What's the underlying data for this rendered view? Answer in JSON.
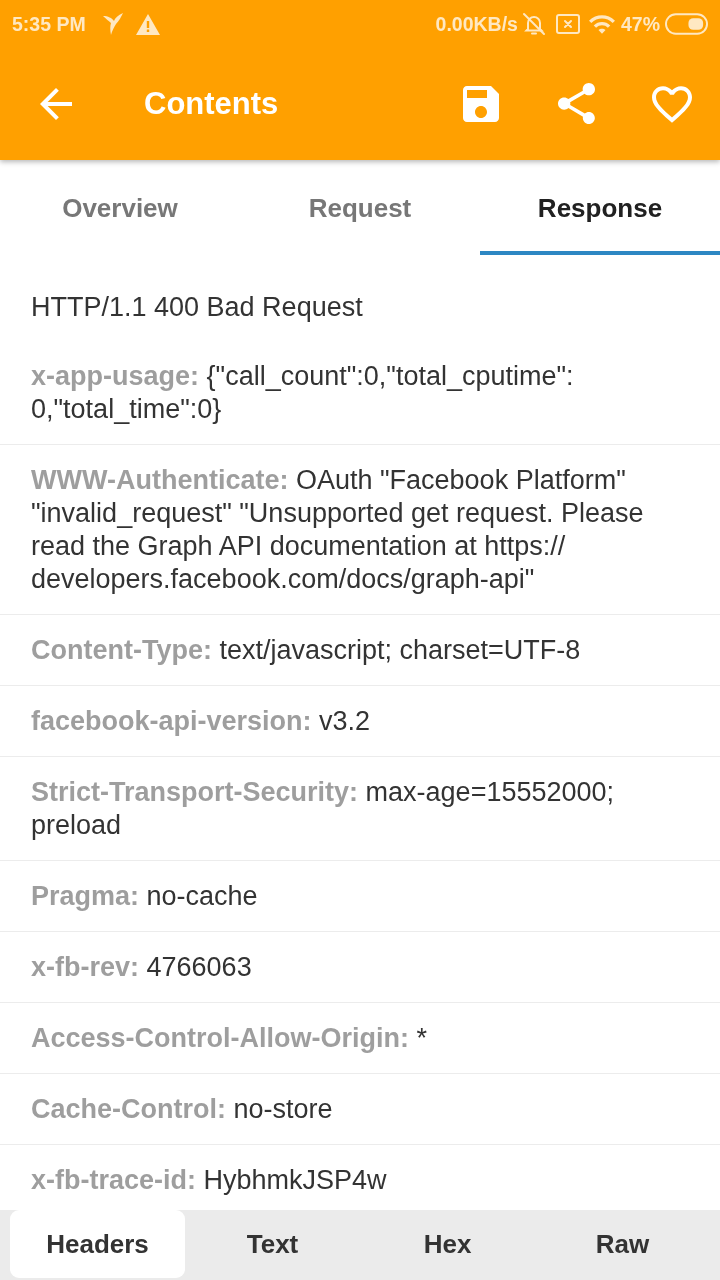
{
  "status_bar": {
    "time": "5:35 PM",
    "network_speed": "0.00KB/s",
    "battery": "47%"
  },
  "toolbar": {
    "title": "Contents"
  },
  "tabs": [
    {
      "label": "Overview",
      "selected": false
    },
    {
      "label": "Request",
      "selected": false
    },
    {
      "label": "Response",
      "selected": true
    }
  ],
  "response": {
    "status_line": "HTTP/1.1 400 Bad Request",
    "headers": [
      {
        "label": "x-app-usage:",
        "value": "{\"call_count\":0,\"total_cputime\":0,\"total_time\":0}"
      },
      {
        "label": "WWW-Authenticate:",
        "value": "OAuth \"Facebook Platform\" \"invalid_request\" \"Unsupported get request. Please read the Graph API documentation at https://developers.facebook.com/docs/graph-api\""
      },
      {
        "label": "Content-Type:",
        "value": "text/javascript; charset=UTF-8"
      },
      {
        "label": "facebook-api-version:",
        "value": "v3.2"
      },
      {
        "label": "Strict-Transport-Security:",
        "value": "max-age=15552000; preload"
      },
      {
        "label": "Pragma:",
        "value": "no-cache"
      },
      {
        "label": "x-fb-rev:",
        "value": "4766063"
      },
      {
        "label": "Access-Control-Allow-Origin:",
        "value": "*"
      },
      {
        "label": "Cache-Control:",
        "value": "no-store"
      },
      {
        "label": "x-fb-trace-id:",
        "value": "HybhmkJSP4w"
      }
    ]
  },
  "view_tabs": [
    {
      "label": "Headers",
      "selected": true
    },
    {
      "label": "Text",
      "selected": false
    },
    {
      "label": "Hex",
      "selected": false
    },
    {
      "label": "Raw",
      "selected": false
    }
  ]
}
